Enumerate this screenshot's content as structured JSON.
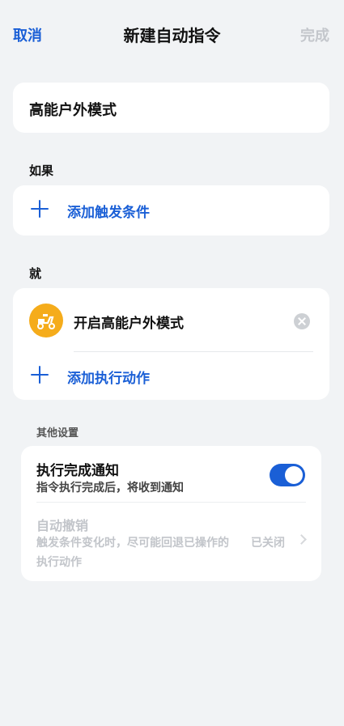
{
  "nav": {
    "cancel": "取消",
    "title": "新建自动指令",
    "done": "完成"
  },
  "command_name": "高能户外模式",
  "if_section": {
    "label": "如果",
    "add_trigger": "添加触发条件"
  },
  "then_section": {
    "label": "就",
    "action": {
      "label": "开启高能户外模式",
      "icon": "scooter-icon",
      "icon_color": "#f5ac1b"
    },
    "add_action": "添加执行动作"
  },
  "other": {
    "label": "其他设置",
    "notify": {
      "title": "执行完成通知",
      "subtitle": "指令执行完成后，将收到通知",
      "enabled": true
    },
    "auto_undo": {
      "title": "自动撤销",
      "subtitle": "触发条件变化时，尽可能回退已操作的执行动作",
      "status": "已关闭"
    }
  },
  "colors": {
    "accent": "#1a5fd6",
    "background": "#f1f3f5",
    "disabled": "#c2c5ca"
  }
}
